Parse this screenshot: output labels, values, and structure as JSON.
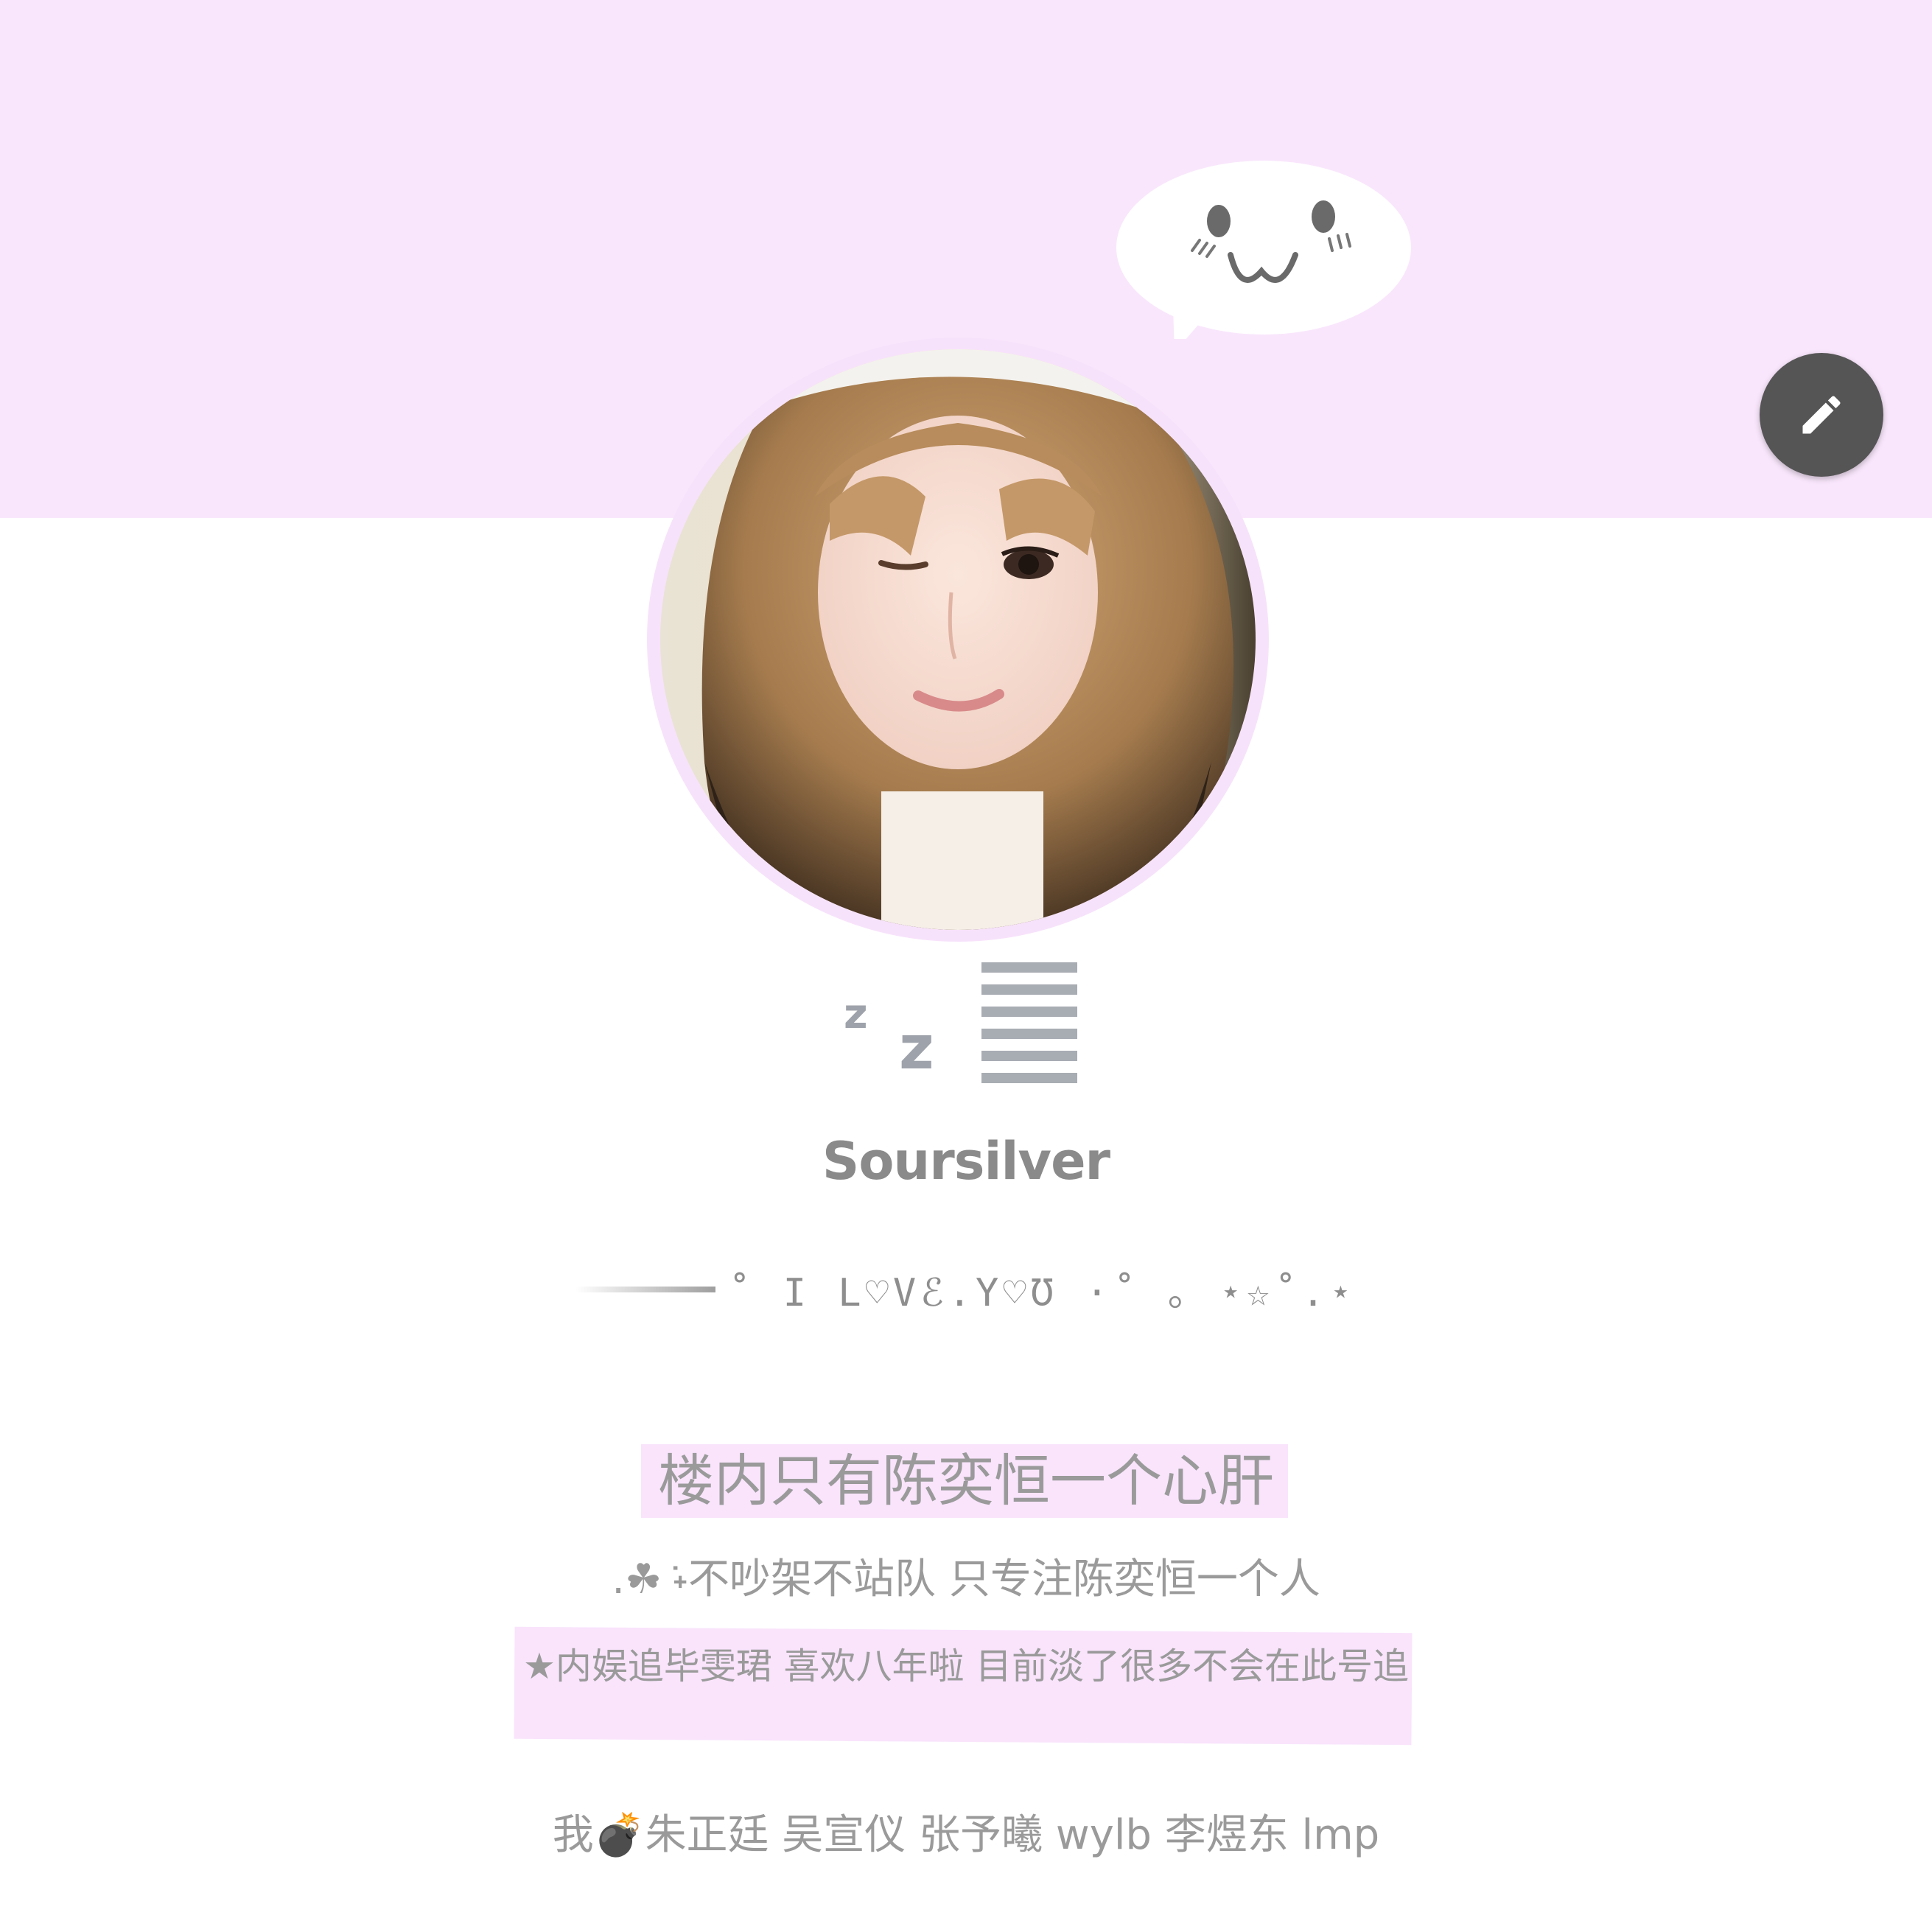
{
  "profile": {
    "username": "Soursilver",
    "tagline": "˚ I L♡Vℰ.Y♡Ʊ ·˚ ｡ ⋆☆˚.⋆",
    "bio": {
      "line1": "楼内只有陈奕恒一个心肝",
      "line2": ".☘︎ ݁˖不吵架不站队 只专注陈奕恒一个人",
      "line3": "★内娱追毕雯珺 喜欢八年啦 目前淡了很多不会在此号追",
      "line4": "我💣朱正廷 吴宣仪 张予曦 wylb 李煜东 lmp"
    }
  },
  "colors": {
    "banner": "#f9e6fc",
    "highlight": "#f9e4fc",
    "text": "#9a9a9a",
    "edit_button": "#555555"
  },
  "icons": {
    "edit": "pencil-icon",
    "speech_bubble": "speech-bubble-face-icon",
    "sleep": "zzz-sleep-icon"
  }
}
